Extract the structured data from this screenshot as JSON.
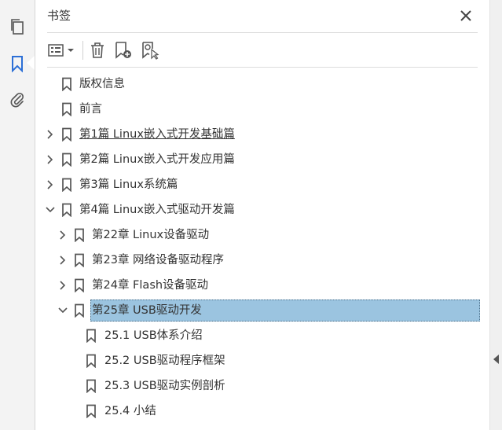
{
  "rail": {
    "items": [
      {
        "icon": "pages-icon"
      },
      {
        "icon": "bookmark-icon",
        "active": true
      },
      {
        "icon": "attachment-icon"
      }
    ]
  },
  "panel": {
    "title": "书签",
    "close_icon": "close-icon"
  },
  "toolbar": {
    "options_icon": "options-menu-icon",
    "delete_icon": "trash-icon",
    "new_bookmark_icon": "new-bookmark-icon",
    "find_bookmark_icon": "find-current-bookmark-icon"
  },
  "bookmarks": [
    {
      "label": "版权信息",
      "level": 0,
      "expander": "none"
    },
    {
      "label": "前言",
      "level": 0,
      "expander": "none"
    },
    {
      "label": "第1篇 Linux嵌入式开发基础篇",
      "level": 0,
      "expander": "collapsed",
      "underlined": true
    },
    {
      "label": "第2篇 Linux嵌入式开发应用篇",
      "level": 0,
      "expander": "collapsed"
    },
    {
      "label": "第3篇 Linux系统篇",
      "level": 0,
      "expander": "collapsed"
    },
    {
      "label": "第4篇 Linux嵌入式驱动开发篇",
      "level": 0,
      "expander": "expanded"
    },
    {
      "label": "第22章 Linux设备驱动",
      "level": 1,
      "expander": "collapsed"
    },
    {
      "label": "第23章 网络设备驱动程序",
      "level": 1,
      "expander": "collapsed"
    },
    {
      "label": "第24章 Flash设备驱动",
      "level": 1,
      "expander": "collapsed"
    },
    {
      "label": "第25章 USB驱动开发",
      "level": 1,
      "expander": "expanded",
      "selected": true
    },
    {
      "label": "25.1 USB体系介绍",
      "level": 2,
      "expander": "none"
    },
    {
      "label": "25.2 USB驱动程序框架",
      "level": 2,
      "expander": "none"
    },
    {
      "label": "25.3 USB驱动实例剖析",
      "level": 2,
      "expander": "none"
    },
    {
      "label": "25.4 小结",
      "level": 2,
      "expander": "none"
    }
  ],
  "colors": {
    "selection": "#9bc4e0",
    "active_icon": "#2c6fd6",
    "icon": "#555555"
  }
}
